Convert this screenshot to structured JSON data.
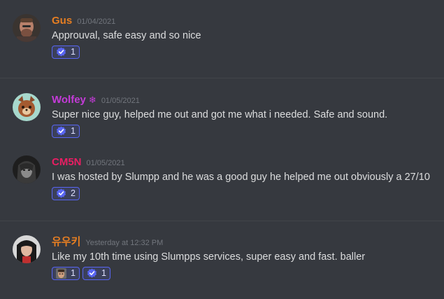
{
  "colors": {
    "background": "#36393f",
    "divider": "#42454a",
    "reaction_bg": "#3b405a",
    "reaction_border": "#5865f2",
    "timestamp": "#72767d",
    "text": "#dcddde"
  },
  "messages": [
    {
      "username": "Gus",
      "username_color": "#e67e22",
      "badge": "",
      "timestamp": "01/04/2021",
      "content": "Approuval, safe easy and so nice",
      "reactions": [
        {
          "emoji": "verified-check-icon",
          "count": "1"
        }
      ]
    },
    {
      "username": "Wolfey",
      "username_color": "#c43bd8",
      "badge": "❄",
      "timestamp": "01/05/2021",
      "content": "Super nice guy, helped me out and got me what i needed. Safe and sound.",
      "reactions": [
        {
          "emoji": "verified-check-icon",
          "count": "1"
        }
      ]
    },
    {
      "username": "CM5N",
      "username_color": "#e91e63",
      "badge": "",
      "timestamp": "01/05/2021",
      "content": "I was hosted by Slumpp and he was a good guy he helped me out obviously a 27/10",
      "reactions": [
        {
          "emoji": "verified-check-icon",
          "count": "2"
        }
      ]
    },
    {
      "username": "유우키",
      "username_color": "#e67e22",
      "badge": "",
      "timestamp": "Yesterday at 12:32 PM",
      "content": "Like my 10th time using Slumpps services, super easy and fast. baller",
      "reactions": [
        {
          "emoji": "custom-face-icon",
          "count": "1"
        },
        {
          "emoji": "verified-check-icon",
          "count": "1"
        }
      ]
    }
  ]
}
